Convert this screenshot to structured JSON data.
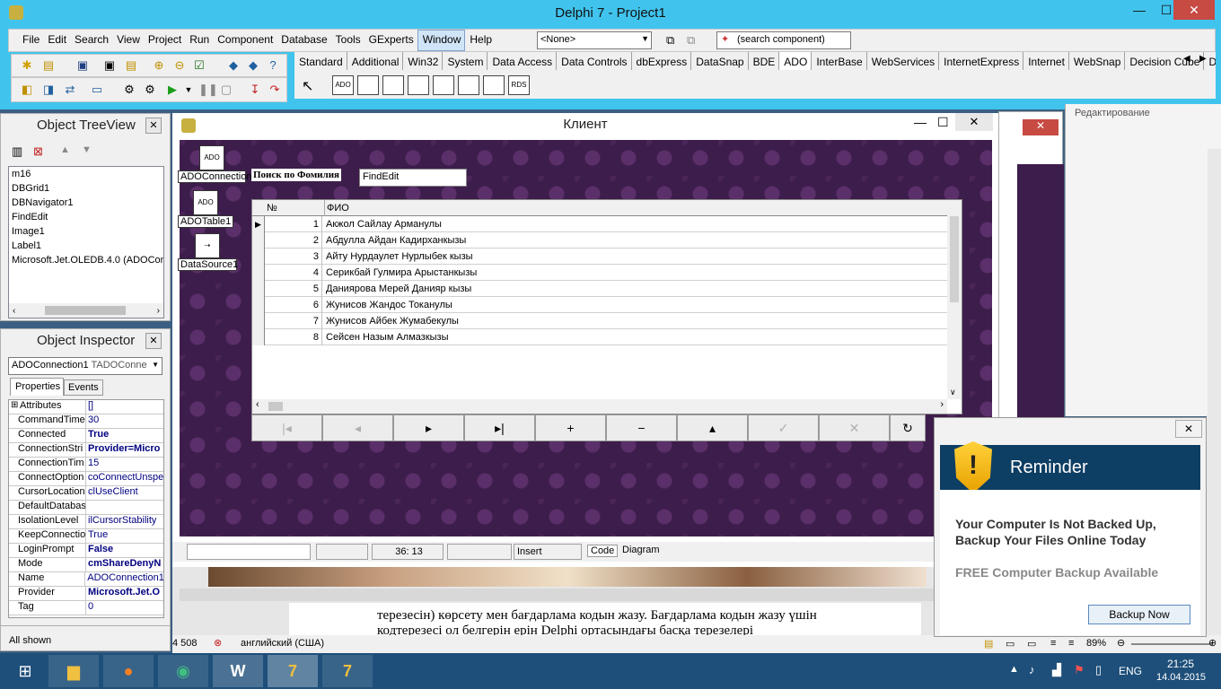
{
  "window": {
    "title": "Delphi 7 - Project1",
    "minimize": "—",
    "maximize": "☐",
    "close": "✕"
  },
  "menu": [
    "File",
    "Edit",
    "Search",
    "View",
    "Project",
    "Run",
    "Component",
    "Database",
    "Tools",
    "GExperts",
    "Window",
    "Help"
  ],
  "toolbar": {
    "config_combo": "<None>",
    "search_component": "(search component)"
  },
  "palette_tabs": [
    "Standard",
    "Additional",
    "Win32",
    "System",
    "Data Access",
    "Data Controls",
    "dbExpress",
    "DataSnap",
    "BDE",
    "ADO",
    "InterBase",
    "WebServices",
    "InternetExpress",
    "Internet",
    "WebSnap",
    "Decision Cube",
    "Dialo"
  ],
  "palette_icons": [
    "ADO",
    "",
    "",
    "",
    "",
    "",
    "",
    "RDS"
  ],
  "tree_view": {
    "title": "Object TreeView",
    "items": [
      "m16",
      "DBGrid1",
      "DBNavigator1",
      "FindEdit",
      "Image1",
      "Label1",
      "Microsoft.Jet.OLEDB.4.0 (ADOCon"
    ]
  },
  "inspector": {
    "title": "Object Inspector",
    "selected": "ADOConnection1",
    "selected_type": "TADOConne",
    "tab_properties": "Properties",
    "tab_events": "Events",
    "footer": "All shown",
    "props": [
      {
        "name": "Attributes",
        "value": "[]",
        "bold": false,
        "expand": "⊞"
      },
      {
        "name": "CommandTime",
        "value": "30",
        "bold": false
      },
      {
        "name": "Connected",
        "value": "True",
        "bold": true
      },
      {
        "name": "ConnectionStri",
        "value": "Provider=Micro",
        "bold": true
      },
      {
        "name": "ConnectionTim",
        "value": "15",
        "bold": false
      },
      {
        "name": "ConnectOption",
        "value": "coConnectUnspe",
        "bold": false
      },
      {
        "name": "CursorLocation",
        "value": "clUseClient",
        "bold": false
      },
      {
        "name": "DefaultDatabas",
        "value": "",
        "bold": false
      },
      {
        "name": "IsolationLevel",
        "value": "ilCursorStability",
        "bold": false
      },
      {
        "name": "KeepConnectio",
        "value": "True",
        "bold": false
      },
      {
        "name": "LoginPrompt",
        "value": "False",
        "bold": true
      },
      {
        "name": "Mode",
        "value": "cmShareDenyN",
        "bold": true
      },
      {
        "name": "Name",
        "value": "ADOConnection1",
        "bold": false
      },
      {
        "name": "Provider",
        "value": "Microsoft.Jet.O",
        "bold": true
      },
      {
        "name": "Tag",
        "value": "0",
        "bold": false
      }
    ]
  },
  "form": {
    "title": "Клиент",
    "search_label": "Поиск по Фомилия",
    "find_edit": "FindEdit",
    "components": [
      "ADOConnection1",
      "ADOTable1",
      "DataSource1"
    ],
    "grid_headers": [
      "№",
      "ФИО"
    ],
    "rows": [
      {
        "n": "1",
        "fio": "Акжол Сайлау  Арманулы"
      },
      {
        "n": "2",
        "fio": "Абдулла Айдан Кадирханкызы"
      },
      {
        "n": "3",
        "fio": "Айту Нурдаулет Нурлыбек кызы"
      },
      {
        "n": "4",
        "fio": "Серикбай Гулмира Арыстанкызы"
      },
      {
        "n": "5",
        "fio": "Даниярова Мерей Данияр кызы"
      },
      {
        "n": "6",
        "fio": "Жунисов Жандос Токанулы"
      },
      {
        "n": "7",
        "fio": "Жунисов Айбек Жумабекулы"
      },
      {
        "n": "8",
        "fio": "Сейсен Назым Алмазкызы"
      }
    ],
    "nav": [
      "|◂",
      "◂",
      "▸",
      "▸|",
      "+",
      "−",
      "▴",
      "✓",
      "✕",
      "↻"
    ]
  },
  "editor_status": {
    "position": "36: 13",
    "mode": "Insert",
    "tab_code": "Code",
    "tab_diagram": "Diagram"
  },
  "word": {
    "line1": "терезесін) көрсету мен бағдарлама кодын жазу. Бағдарлама кодын жазу үшін",
    "line2": "кодтерезесі ол белгерін ерін Delphi ортасындағы басқа терезелері",
    "words": "4 508",
    "lang": "английский (США)",
    "zoom": "89%",
    "right_label": "Редактирование"
  },
  "reminder": {
    "title": "Reminder",
    "line1": "Your Computer Is Not Backed Up,",
    "line2": "Backup Your Files Online Today",
    "line3": "FREE Computer Backup Available",
    "button": "Backup Now"
  },
  "taskbar": {
    "lang": "ENG",
    "time": "21:25",
    "date": "14.04.2015"
  }
}
